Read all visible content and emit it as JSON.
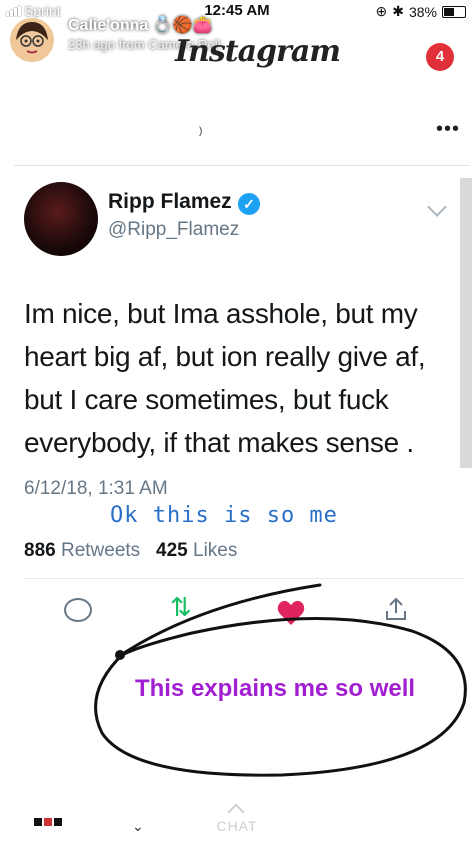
{
  "status_bar": {
    "carrier": "Sprint",
    "time": "12:45 AM",
    "battery": "38%"
  },
  "story": {
    "username": "Calie'onna",
    "emojis": "💍🏀👛",
    "subtitle": "23h ago from Camera Roll"
  },
  "background_app": {
    "logo": "Instagram",
    "notification_count": "4",
    "more_icon": "more-dots-icon"
  },
  "tweet": {
    "display_name": "Ripp Flamez",
    "handle": "@Ripp_Flamez",
    "text": "Im nice, but Ima asshole, but my heart big af, but ion really give af, but I care sometimes, but fuck everybody, if that makes sense .",
    "date": "6/12/18, 1:31 AM",
    "retweets": "886",
    "retweets_label": "Retweets",
    "likes": "425",
    "likes_label": "Likes",
    "actions": [
      "reply-icon",
      "retweet-icon",
      "heart-icon",
      "share-icon"
    ],
    "colors": {
      "verified": "#1da1f2",
      "retweet": "#17bf63",
      "liked": "#e0245e"
    }
  },
  "captions": {
    "mono": "Ok this is so me",
    "circled": "This explains me so well",
    "circled_color": "#a21fd1"
  },
  "bottom_bar": {
    "chat_label": "CHAT"
  }
}
